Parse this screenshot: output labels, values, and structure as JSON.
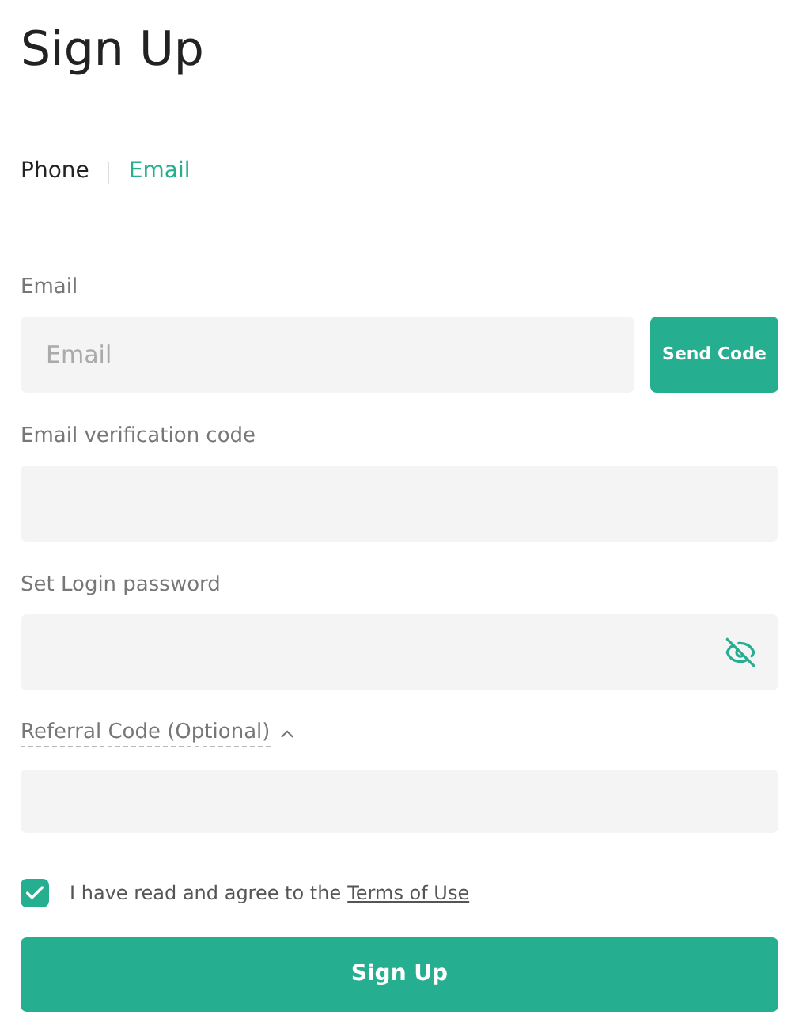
{
  "title": "Sign Up",
  "tabs": [
    {
      "label": "Phone",
      "selected": false
    },
    {
      "label": "Email",
      "selected": true
    }
  ],
  "email": {
    "label": "Email",
    "placeholder": "Email",
    "button": "Send Code"
  },
  "verification": {
    "label": "Email verification code"
  },
  "password": {
    "label": "Set Login password",
    "visible": false
  },
  "referral": {
    "label": "Referral Code (Optional)",
    "expanded": true
  },
  "terms": {
    "checked": true,
    "text": "I have read and agree to the",
    "link": "Terms of Use"
  },
  "submit": "Sign Up"
}
